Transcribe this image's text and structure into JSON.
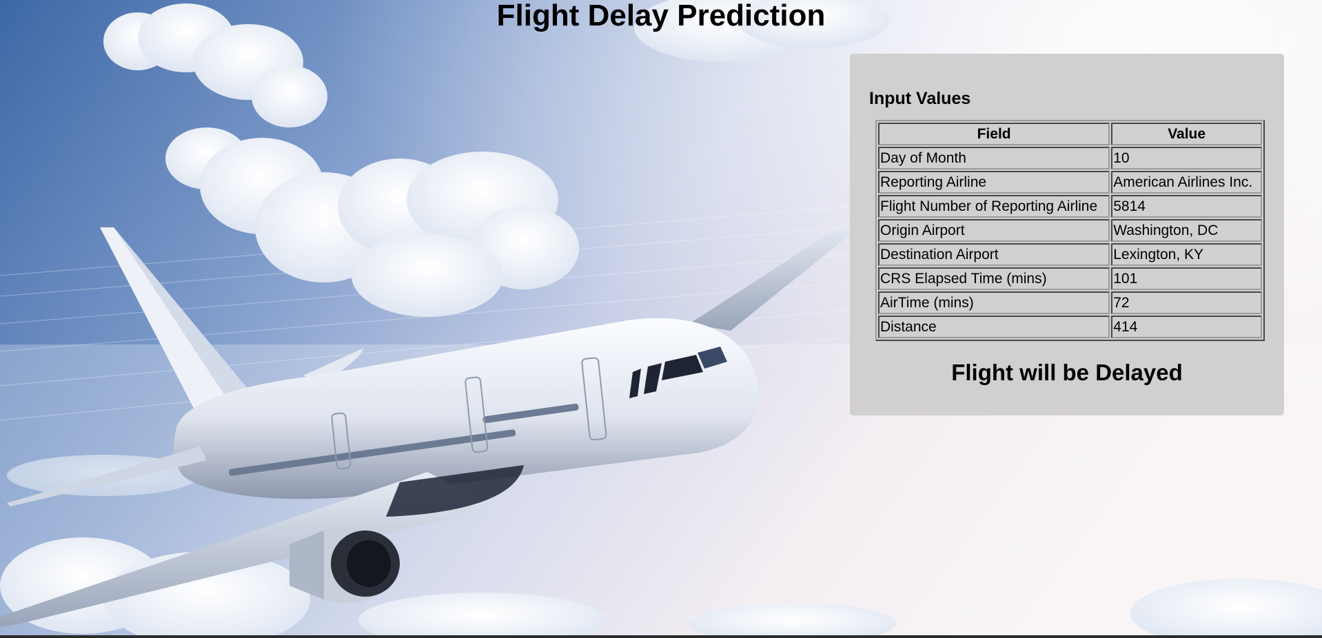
{
  "page": {
    "title": "Flight Delay Prediction"
  },
  "panel": {
    "heading": "Input Values",
    "table": {
      "headers": [
        "Field",
        "Value"
      ],
      "rows": [
        {
          "field": "Day of Month",
          "value": "10"
        },
        {
          "field": "Reporting Airline",
          "value": "American Airlines Inc."
        },
        {
          "field": "Flight Number of Reporting Airline",
          "value": "5814"
        },
        {
          "field": "Origin Airport",
          "value": "Washington, DC"
        },
        {
          "field": "Destination Airport",
          "value": "Lexington, KY"
        },
        {
          "field": "CRS Elapsed Time (mins)",
          "value": "101"
        },
        {
          "field": "AirTime (mins)",
          "value": "72"
        },
        {
          "field": "Distance",
          "value": "414"
        }
      ]
    },
    "result": "Flight will be Delayed"
  },
  "colors": {
    "panel_background": "#d1d0cf",
    "sky_top_left": "#3f6aa6",
    "sky_right": "#f3ecef"
  },
  "background_image": {
    "icon": "airplane-in-sky-photo"
  }
}
